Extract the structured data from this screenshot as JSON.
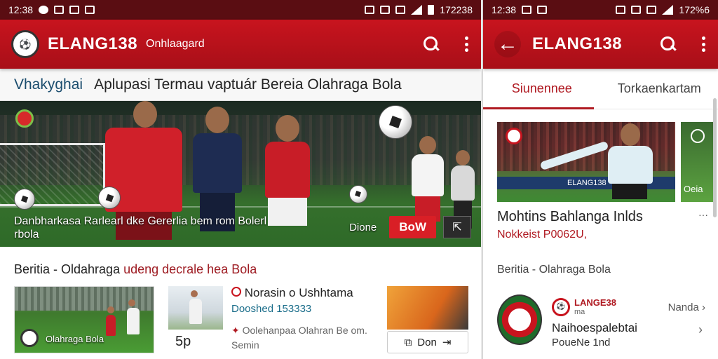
{
  "left": {
    "status": {
      "time": "12:38",
      "right_text": "172238"
    },
    "appbar": {
      "brand": "ELANG138",
      "subtitle": "Onhlaagard"
    },
    "breadcrumb": {
      "first": "Vhakyghai",
      "title": "Aplupasi Termau vaptuár Bereia Olahraga Bola"
    },
    "hero": {
      "caption": "Danbharkasa Rarlearl dke Gererlia bem rom Bolerl rbola",
      "done_label": "Dione",
      "primary_button": "BoW"
    },
    "section": {
      "title_plain": "Beritia - Oldahraga ",
      "title_highlight": "udeng decrale hea Bola"
    },
    "cards": [
      {
        "caption": "Olahraga Bola"
      },
      {
        "title": "Norasin o Ushhtama",
        "line1": "Dooshed 153333",
        "line2": "Oolehanpaa Olahran Be om.",
        "line3": "Semin",
        "side": "5p"
      },
      {
        "button": "Don"
      }
    ]
  },
  "right": {
    "status": {
      "time": "12:38",
      "right_text": "172%6"
    },
    "appbar": {
      "brand": "ELANG138"
    },
    "tabs": [
      "Siunennee",
      "Torkaenkartam"
    ],
    "hero": {
      "banner": "ELANG138",
      "side_label": "Oeia"
    },
    "article": {
      "title": "Mohtins Bahlanga Inlds",
      "meta": "Nokkeist P0062U,",
      "more": "···"
    },
    "section_label": "Beritia - Olahraga Bola",
    "list_item": {
      "logo_text": "LANGE38",
      "logo_sub": "ma",
      "title": "Naihoespalebtai",
      "subtitle": "PoueNe 1nd",
      "side_label": "Nanda"
    }
  },
  "colors": {
    "primary_red": "#c8141e",
    "status_bar": "#5a0d12",
    "accent_text": "#b01a22"
  },
  "icons": [
    "back-icon",
    "search-icon",
    "more-vert-icon",
    "share-icon",
    "chevron-right-icon",
    "signal-icon",
    "battery-icon"
  ]
}
